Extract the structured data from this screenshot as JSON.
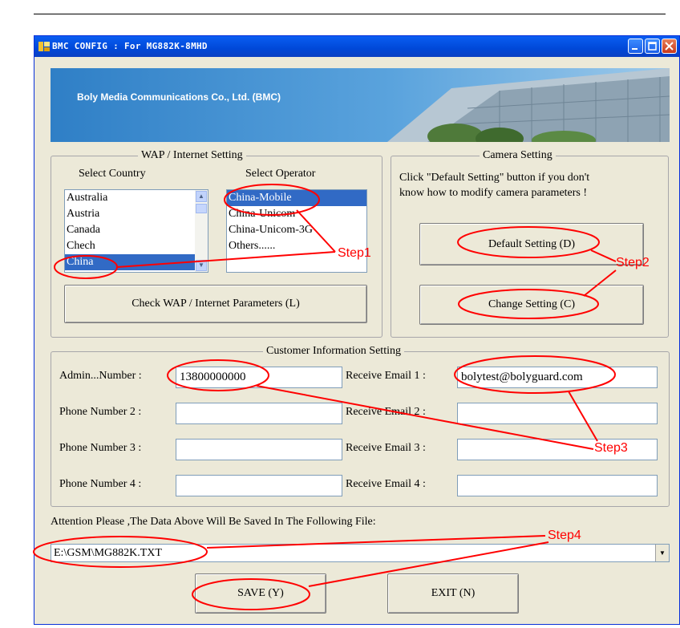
{
  "window": {
    "title": "BMC CONFIG : For MG882K-8MHD"
  },
  "banner": {
    "company": "Boly Media Communications Co., Ltd. (BMC)"
  },
  "wap": {
    "legend": "WAP / Internet Setting",
    "country_label": "Select Country",
    "operator_label": "Select Operator",
    "countries": [
      "Australia",
      "Austria",
      "Canada",
      "Chech",
      "China"
    ],
    "selected_country": "China",
    "operators": [
      "China-Mobile",
      "China-Unicom",
      "China-Unicom-3G",
      "Others......"
    ],
    "selected_operator": "China-Mobile",
    "check_button": "Check WAP / Internet Parameters (L)"
  },
  "camera": {
    "legend": "Camera Setting",
    "note_line1": "Click \"Default Setting\" button if you don't",
    "note_line2": "know how to modify camera parameters !",
    "default_button": "Default Setting (D)",
    "change_button": "Change Setting (C)"
  },
  "customer": {
    "legend": "Customer Information Setting",
    "phones": [
      {
        "label": "Admin...Number :",
        "value": "13800000000"
      },
      {
        "label": "Phone Number 2 :",
        "value": ""
      },
      {
        "label": "Phone Number 3 :",
        "value": ""
      },
      {
        "label": "Phone Number 4 :",
        "value": ""
      }
    ],
    "emails": [
      {
        "label": "Receive Email 1 :",
        "value": "bolytest@bolyguard.com"
      },
      {
        "label": "Receive Email 2 :",
        "value": ""
      },
      {
        "label": "Receive Email 3 :",
        "value": ""
      },
      {
        "label": "Receive Email 4 :",
        "value": ""
      }
    ]
  },
  "file": {
    "attention": "Attention Please ,The Data Above Will Be Saved In The Following  File:",
    "path": "E:\\GSM\\MG882K.TXT"
  },
  "actions": {
    "save": "SAVE (Y)",
    "exit": "EXIT (N)"
  },
  "annotations": {
    "step1": "Step1",
    "step2": "Step2",
    "step3": "Step3",
    "step4": "Step4"
  },
  "colors": {
    "annotation": "#ff0000",
    "selection": "#316ac5",
    "titlebar": "#0054e3",
    "window_bg": "#ece9d8"
  }
}
